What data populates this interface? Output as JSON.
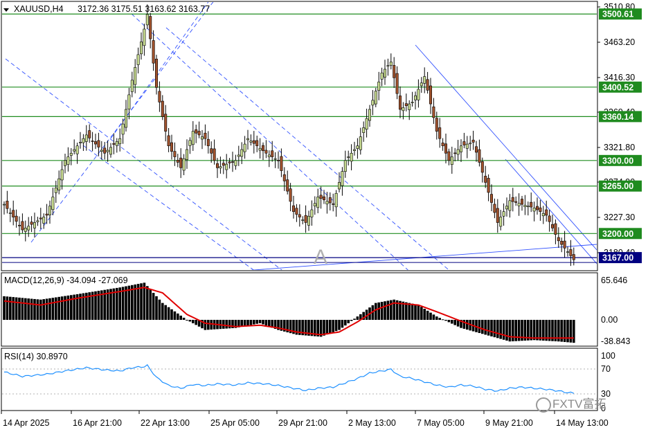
{
  "header": {
    "symbol": "XAUUSD,H4",
    "ohlc": "3172.36 3175.51 3163.62 3163.77"
  },
  "price_axis": {
    "ticks": [
      "3510.80",
      "3463.20",
      "3416.30",
      "3369.40",
      "3321.80",
      "3274.90",
      "3227.30",
      "3180.40"
    ],
    "levels": [
      {
        "label": "3500.61",
        "value": 3500.61
      },
      {
        "label": "3400.52",
        "value": 3400.52
      },
      {
        "label": "3360.14",
        "value": 3360.14
      },
      {
        "label": "3300.00",
        "value": 3300.0
      },
      {
        "label": "3265.00",
        "value": 3265.0
      },
      {
        "label": "3200.00",
        "value": 3200.0
      },
      {
        "label": "3167.00",
        "value": 3167.0
      }
    ],
    "level_color": "#1f8b1f",
    "highlight_color": "#000080"
  },
  "annotation": {
    "text": "A"
  },
  "macd": {
    "label": "MACD(12,26,9) -34.094 -27.069",
    "ticks": [
      "65.646",
      "0.00",
      "-38.843"
    ],
    "signal_color": "#e00000"
  },
  "rsi": {
    "label": "RSI(14) 30.8970",
    "ticks": [
      "100",
      "70",
      "30",
      "0"
    ],
    "line_color": "#1e90ff"
  },
  "time_axis": {
    "labels": [
      "14 Apr 2025",
      "16 Apr 21:00",
      "22 Apr 13:00",
      "25 Apr 05:00",
      "29 Apr 21:00",
      "2 May 13:00",
      "7 May 05:00",
      "9 May 21:00",
      "14 May 13:00"
    ]
  },
  "watermark": "FXTV富拓",
  "chart_data": {
    "type": "candlestick",
    "title": "XAUUSD,H4",
    "ylim": [
      3155,
      3520
    ],
    "close_path": [
      [
        0,
        3240
      ],
      [
        6,
        3205
      ],
      [
        14,
        3225
      ],
      [
        20,
        3300
      ],
      [
        27,
        3335
      ],
      [
        33,
        3310
      ],
      [
        38,
        3330
      ],
      [
        42,
        3410
      ],
      [
        46,
        3480
      ],
      [
        47,
        3500
      ],
      [
        50,
        3400
      ],
      [
        54,
        3320
      ],
      [
        58,
        3290
      ],
      [
        62,
        3340
      ],
      [
        66,
        3330
      ],
      [
        70,
        3290
      ],
      [
        76,
        3300
      ],
      [
        80,
        3330
      ],
      [
        86,
        3310
      ],
      [
        90,
        3300
      ],
      [
        95,
        3230
      ],
      [
        99,
        3215
      ],
      [
        103,
        3250
      ],
      [
        108,
        3240
      ],
      [
        112,
        3300
      ],
      [
        116,
        3320
      ],
      [
        120,
        3370
      ],
      [
        124,
        3420
      ],
      [
        127,
        3435
      ],
      [
        130,
        3370
      ],
      [
        134,
        3380
      ],
      [
        138,
        3415
      ],
      [
        142,
        3340
      ],
      [
        146,
        3300
      ],
      [
        150,
        3320
      ],
      [
        154,
        3325
      ],
      [
        158,
        3270
      ],
      [
        162,
        3215
      ],
      [
        166,
        3245
      ],
      [
        170,
        3240
      ],
      [
        174,
        3235
      ],
      [
        178,
        3225
      ],
      [
        182,
        3190
      ],
      [
        185,
        3175
      ],
      [
        187,
        3164
      ]
    ],
    "macd_histogram_path": [
      [
        0,
        35
      ],
      [
        12,
        30
      ],
      [
        24,
        38
      ],
      [
        38,
        48
      ],
      [
        46,
        55
      ],
      [
        52,
        25
      ],
      [
        60,
        0
      ],
      [
        66,
        -15
      ],
      [
        76,
        -12
      ],
      [
        84,
        -5
      ],
      [
        90,
        -15
      ],
      [
        96,
        -22
      ],
      [
        104,
        -25
      ],
      [
        110,
        -15
      ],
      [
        116,
        5
      ],
      [
        122,
        25
      ],
      [
        128,
        30
      ],
      [
        136,
        22
      ],
      [
        142,
        5
      ],
      [
        150,
        -12
      ],
      [
        158,
        -22
      ],
      [
        166,
        -32
      ],
      [
        174,
        -30
      ],
      [
        182,
        -32
      ],
      [
        187,
        -34
      ]
    ],
    "macd_signal_path": [
      [
        0,
        28
      ],
      [
        12,
        22
      ],
      [
        24,
        32
      ],
      [
        38,
        42
      ],
      [
        46,
        48
      ],
      [
        52,
        40
      ],
      [
        60,
        8
      ],
      [
        66,
        -5
      ],
      [
        76,
        -10
      ],
      [
        84,
        -8
      ],
      [
        90,
        -12
      ],
      [
        96,
        -18
      ],
      [
        104,
        -22
      ],
      [
        110,
        -18
      ],
      [
        116,
        -3
      ],
      [
        122,
        15
      ],
      [
        128,
        25
      ],
      [
        136,
        22
      ],
      [
        142,
        12
      ],
      [
        150,
        -2
      ],
      [
        158,
        -15
      ],
      [
        166,
        -25
      ],
      [
        174,
        -27
      ],
      [
        182,
        -27
      ],
      [
        187,
        -27
      ]
    ],
    "rsi_path": [
      [
        0,
        70
      ],
      [
        6,
        62
      ],
      [
        14,
        66
      ],
      [
        20,
        72
      ],
      [
        27,
        78
      ],
      [
        33,
        74
      ],
      [
        38,
        72
      ],
      [
        42,
        78
      ],
      [
        46,
        80
      ],
      [
        47,
        82
      ],
      [
        50,
        60
      ],
      [
        54,
        45
      ],
      [
        58,
        40
      ],
      [
        62,
        47
      ],
      [
        66,
        45
      ],
      [
        70,
        48
      ],
      [
        76,
        46
      ],
      [
        80,
        50
      ],
      [
        86,
        48
      ],
      [
        90,
        45
      ],
      [
        95,
        40
      ],
      [
        99,
        36
      ],
      [
        103,
        40
      ],
      [
        108,
        42
      ],
      [
        112,
        50
      ],
      [
        116,
        58
      ],
      [
        120,
        68
      ],
      [
        124,
        72
      ],
      [
        127,
        75
      ],
      [
        130,
        62
      ],
      [
        134,
        58
      ],
      [
        138,
        52
      ],
      [
        142,
        46
      ],
      [
        146,
        42
      ],
      [
        150,
        46
      ],
      [
        154,
        44
      ],
      [
        158,
        38
      ],
      [
        162,
        35
      ],
      [
        166,
        40
      ],
      [
        170,
        42
      ],
      [
        174,
        40
      ],
      [
        178,
        38
      ],
      [
        182,
        35
      ],
      [
        185,
        32
      ],
      [
        187,
        31
      ]
    ]
  }
}
